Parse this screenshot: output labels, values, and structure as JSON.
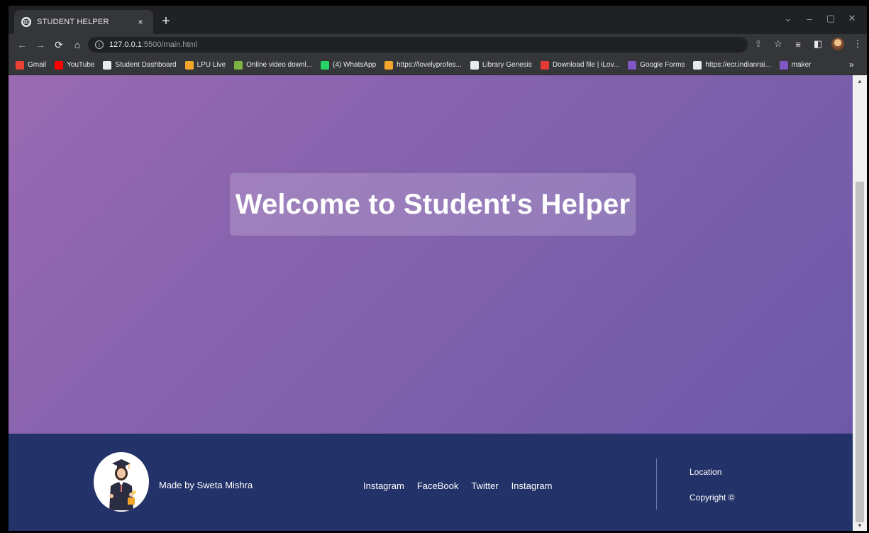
{
  "browser": {
    "tab_title": "STUDENT HELPER",
    "tab_close": "×",
    "new_tab": "+",
    "url_host": "127.0.0.1",
    "url_path": ":5500/main.html",
    "window_controls": {
      "chevron": "⌄",
      "minimize": "–",
      "restore": "▢",
      "close": "✕"
    }
  },
  "bookmarks": [
    {
      "label": "Gmail",
      "color": "#ea4335"
    },
    {
      "label": "YouTube",
      "color": "#ff0000"
    },
    {
      "label": "Student Dashboard",
      "color": "#e8eaed"
    },
    {
      "label": "LPU Live",
      "color": "#f4a62a"
    },
    {
      "label": "Online video downl...",
      "color": "#7cb342"
    },
    {
      "label": "(4) WhatsApp",
      "color": "#25d366"
    },
    {
      "label": "https://lovelyprofes...",
      "color": "#f4a62a"
    },
    {
      "label": "Library Genesis",
      "color": "#e8eaed"
    },
    {
      "label": "Download file | iLov...",
      "color": "#e53935"
    },
    {
      "label": "Google Forms",
      "color": "#7e57c2"
    },
    {
      "label": "https://ecr.indianrai...",
      "color": "#e8eaed"
    },
    {
      "label": "maker",
      "color": "#7e57c2"
    }
  ],
  "bookmarks_more": "»",
  "hero": {
    "heading": "Welcome to Student's Helper"
  },
  "footer": {
    "made_by": "Made by Sweta Mishra",
    "social_links": [
      "Instagram",
      "FaceBook",
      "Twitter",
      "Instagram"
    ],
    "location": "Location",
    "copyright": "Copyright ©"
  }
}
